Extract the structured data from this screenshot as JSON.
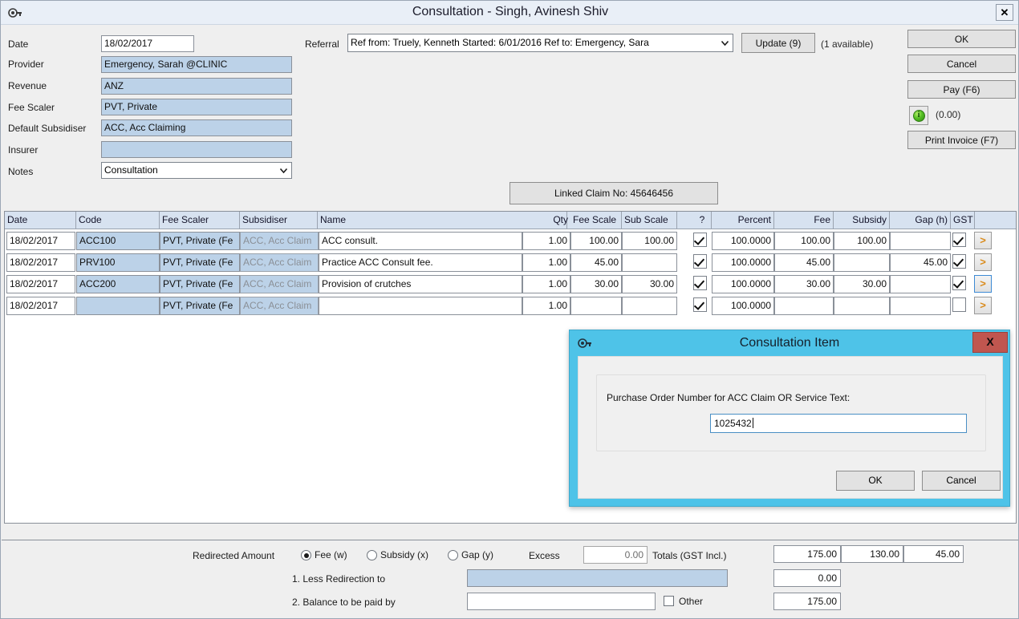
{
  "window": {
    "title": "Consultation - Singh, Avinesh Shiv",
    "close_label": "✕",
    "icon": "key-icon"
  },
  "form": {
    "fields": [
      {
        "label": "Date",
        "value": "18/02/2017",
        "style": "white"
      },
      {
        "label": "Provider",
        "value": "Emergency, Sarah @CLINIC",
        "style": "blue"
      },
      {
        "label": "Revenue",
        "value": "ANZ",
        "style": "blue"
      },
      {
        "label": "Fee Scaler",
        "value": "PVT, Private",
        "style": "blue"
      },
      {
        "label": "Default Subsidiser",
        "value": "ACC, Acc Claiming",
        "style": "blue"
      },
      {
        "label": "Insurer",
        "value": "",
        "style": "blue"
      }
    ],
    "notes": {
      "label": "Notes",
      "value": "Consultation"
    }
  },
  "referral": {
    "label": "Referral",
    "value": "Ref from: Truely, Kenneth Started: 6/01/2016 Ref to: Emergency, Sara",
    "update_button": "Update (9)",
    "available_text": "(1 available)"
  },
  "actions": {
    "ok": "OK",
    "cancel": "Cancel",
    "pay": "Pay (F6)",
    "info_amount": "(0.00)",
    "print_invoice": "Print Invoice (F7)"
  },
  "linked_claim": {
    "label": "Linked Claim No: 45646456"
  },
  "grid": {
    "columns": [
      {
        "key": "date",
        "label": "Date"
      },
      {
        "key": "code",
        "label": "Code"
      },
      {
        "key": "feescaler",
        "label": "Fee Scaler"
      },
      {
        "key": "subsidiser",
        "label": "Subsidiser"
      },
      {
        "key": "name",
        "label": "Name"
      },
      {
        "key": "qty",
        "label": "Qty"
      },
      {
        "key": "feescale",
        "label": "Fee Scale"
      },
      {
        "key": "subscale",
        "label": "Sub Scale"
      },
      {
        "key": "q",
        "label": "?"
      },
      {
        "key": "percent",
        "label": "Percent"
      },
      {
        "key": "fee",
        "label": "Fee"
      },
      {
        "key": "subsidy",
        "label": "Subsidy"
      },
      {
        "key": "gap",
        "label": "Gap (h)"
      },
      {
        "key": "gst",
        "label": "GST"
      },
      {
        "key": "more",
        "label": ""
      }
    ],
    "rows": [
      {
        "date": "18/02/2017",
        "code": "ACC100",
        "feescaler": "PVT, Private (Fe",
        "subsidiser": "ACC, Acc Claim",
        "name": "ACC consult.",
        "qty": "1.00",
        "feescale": "100.00",
        "subscale": "100.00",
        "q": true,
        "percent": "100.0000",
        "fee": "100.00",
        "subsidy": "100.00",
        "gap": "",
        "gst": true,
        "more": ">",
        "more_focus": false
      },
      {
        "date": "18/02/2017",
        "code": "PRV100",
        "feescaler": "PVT, Private (Fe",
        "subsidiser": "ACC, Acc Claim",
        "name": "Practice ACC Consult fee.",
        "qty": "1.00",
        "feescale": "45.00",
        "subscale": "",
        "q": true,
        "percent": "100.0000",
        "fee": "45.00",
        "subsidy": "",
        "gap": "45.00",
        "gst": true,
        "more": ">",
        "more_focus": false
      },
      {
        "date": "18/02/2017",
        "code": "ACC200",
        "feescaler": "PVT, Private (Fe",
        "subsidiser": "ACC, Acc Claim",
        "name": "Provision of crutches",
        "qty": "1.00",
        "feescale": "30.00",
        "subscale": "30.00",
        "q": true,
        "percent": "100.0000",
        "fee": "30.00",
        "subsidy": "30.00",
        "gap": "",
        "gst": true,
        "more": ">",
        "more_focus": true
      },
      {
        "date": "18/02/2017",
        "code": "",
        "feescaler": "PVT, Private (Fe",
        "subsidiser": "ACC, Acc Claim",
        "name": "",
        "qty": "1.00",
        "feescale": "",
        "subscale": "",
        "q": true,
        "percent": "100.0000",
        "fee": "",
        "subsidy": "",
        "gap": "",
        "gst": false,
        "more": ">",
        "more_focus": false
      }
    ]
  },
  "footer": {
    "redirected_label": "Redirected Amount",
    "radios": [
      {
        "label": "Fee (w)",
        "selected": true
      },
      {
        "label": "Subsidy (x)",
        "selected": false
      },
      {
        "label": "Gap (y)",
        "selected": false
      }
    ],
    "excess_label": "Excess",
    "excess_value": "0.00",
    "totals_label": "Totals (GST Incl.)",
    "totals": [
      "175.00",
      "130.00",
      "45.00"
    ],
    "row1_label": "1. Less Redirection to",
    "row1_field": "",
    "row1_value": "0.00",
    "row2_label": "2. Balance to be paid by",
    "row2_field": "",
    "row2_value": "175.00",
    "other_label": "Other",
    "other_checked": false
  },
  "modal": {
    "title": "Consultation Item",
    "icon": "key-icon",
    "close_label": "X",
    "question": "Purchase Order Number for ACC Claim OR Service Text:",
    "input_value": "1025432",
    "ok": "OK",
    "cancel": "Cancel"
  },
  "colors": {
    "field_blue": "#bcd2e8",
    "header_blue": "#d7e2f0",
    "modal_cyan": "#4ec3e8",
    "modal_close_red": "#c0564f",
    "panel_gray": "#efefef",
    "arrow_orange": "#d98a1a",
    "info_green": "#55c024"
  }
}
